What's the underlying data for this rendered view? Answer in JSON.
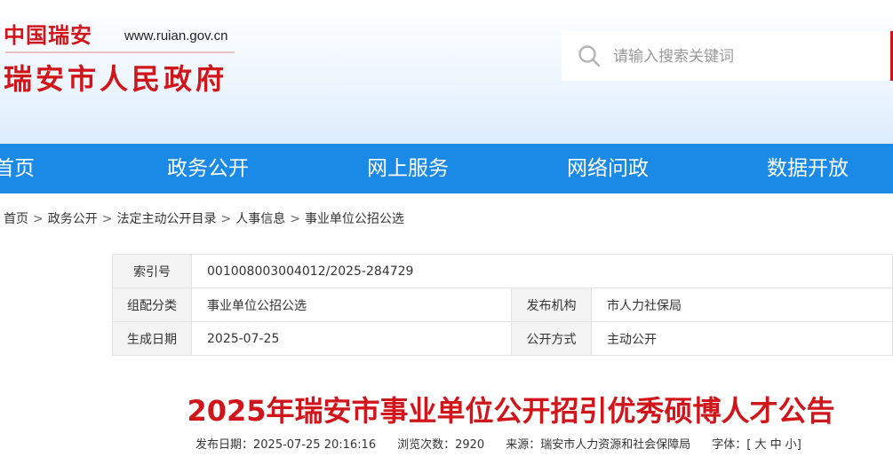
{
  "header": {
    "logo_top": "中国瑞安",
    "site_url": "www.ruian.gov.cn",
    "logo_main": "瑞安市人民政府"
  },
  "search": {
    "placeholder": "请输入搜索关键词"
  },
  "nav": {
    "items": [
      {
        "label": "首页"
      },
      {
        "label": "政务公开"
      },
      {
        "label": "网上服务"
      },
      {
        "label": "网络问政"
      },
      {
        "label": "数据开放"
      }
    ]
  },
  "breadcrumb": {
    "items": [
      "首页",
      "政务公开",
      "法定主动公开目录",
      "人事信息",
      "事业单位公招公选"
    ],
    "separator": ">"
  },
  "info": {
    "index_label": "索引号",
    "index_value": "001008003004012/2025-284729",
    "category_label": "组配分类",
    "category_value": "事业单位公招公选",
    "publisher_label": "发布机构",
    "publisher_value": "市人力社保局",
    "date_label": "生成日期",
    "date_value": "2025-07-25",
    "method_label": "公开方式",
    "method_value": "主动公开"
  },
  "article": {
    "title": "2025年瑞安市事业单位公开招引优秀硕博人才公告",
    "publish_label": "发布日期：",
    "publish_value": "2025-07-25 20:16:16",
    "views_label": "浏览次数：",
    "views_value": "2920",
    "source_label": "来源：",
    "source_value": "瑞安市人力资源和社会保障局",
    "font_label": "字体：",
    "font_open": "[",
    "font_large": "大",
    "font_medium": "中",
    "font_small": "小",
    "font_close": "]"
  },
  "colors": {
    "brand_red": "#d0161b",
    "nav_blue": "#1b8ae6"
  }
}
